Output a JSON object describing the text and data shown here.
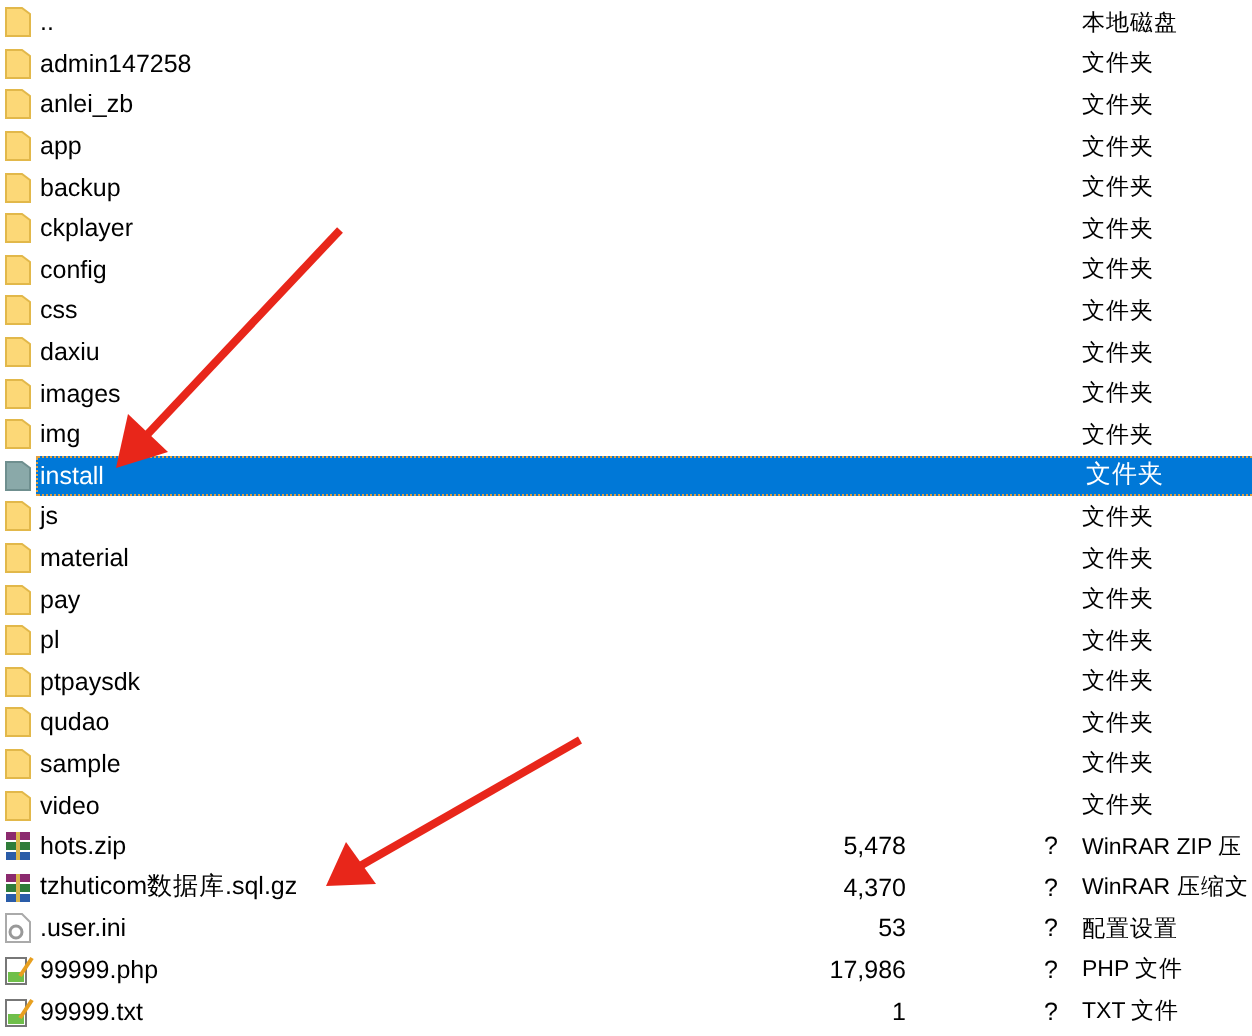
{
  "rows": [
    {
      "kind": "folder",
      "name": "..",
      "type": "本地磁盘",
      "selected": false
    },
    {
      "kind": "folder",
      "name": "admin147258",
      "type": "文件夹",
      "selected": false
    },
    {
      "kind": "folder",
      "name": "anlei_zb",
      "type": "文件夹",
      "selected": false
    },
    {
      "kind": "folder",
      "name": "app",
      "type": "文件夹",
      "selected": false
    },
    {
      "kind": "folder",
      "name": "backup",
      "type": "文件夹",
      "selected": false
    },
    {
      "kind": "folder",
      "name": "ckplayer",
      "type": "文件夹",
      "selected": false
    },
    {
      "kind": "folder",
      "name": "config",
      "type": "文件夹",
      "selected": false
    },
    {
      "kind": "folder",
      "name": "css",
      "type": "文件夹",
      "selected": false
    },
    {
      "kind": "folder",
      "name": "daxiu",
      "type": "文件夹",
      "selected": false
    },
    {
      "kind": "folder",
      "name": "images",
      "type": "文件夹",
      "selected": false
    },
    {
      "kind": "folder",
      "name": "img",
      "type": "文件夹",
      "selected": false
    },
    {
      "kind": "folder",
      "name": "install",
      "type": "文件夹",
      "selected": true
    },
    {
      "kind": "folder",
      "name": "js",
      "type": "文件夹",
      "selected": false
    },
    {
      "kind": "folder",
      "name": "material",
      "type": "文件夹",
      "selected": false
    },
    {
      "kind": "folder",
      "name": "pay",
      "type": "文件夹",
      "selected": false
    },
    {
      "kind": "folder",
      "name": "pl",
      "type": "文件夹",
      "selected": false
    },
    {
      "kind": "folder",
      "name": "ptpaysdk",
      "type": "文件夹",
      "selected": false
    },
    {
      "kind": "folder",
      "name": "qudao",
      "type": "文件夹",
      "selected": false
    },
    {
      "kind": "folder",
      "name": "sample",
      "type": "文件夹",
      "selected": false
    },
    {
      "kind": "folder",
      "name": "video",
      "type": "文件夹",
      "selected": false
    },
    {
      "kind": "archive",
      "name": "hots.zip",
      "size": "5,478",
      "column_3": "?",
      "type": "WinRAR ZIP 压",
      "selected": false
    },
    {
      "kind": "archive",
      "name": "tzhuticom数据库.sql.gz",
      "size": "4,370",
      "column_3": "?",
      "type": "WinRAR 压缩文",
      "selected": false
    },
    {
      "kind": "settings",
      "name": ".user.ini",
      "size": "53",
      "column_3": "?",
      "type": "配置设置",
      "selected": false
    },
    {
      "kind": "text",
      "name": "99999.php",
      "size": "17,986",
      "column_3": "?",
      "type": "PHP 文件",
      "selected": false
    },
    {
      "kind": "text",
      "name": "99999.txt",
      "size": "1",
      "column_3": "?",
      "type": "TXT 文件",
      "selected": false
    }
  ]
}
